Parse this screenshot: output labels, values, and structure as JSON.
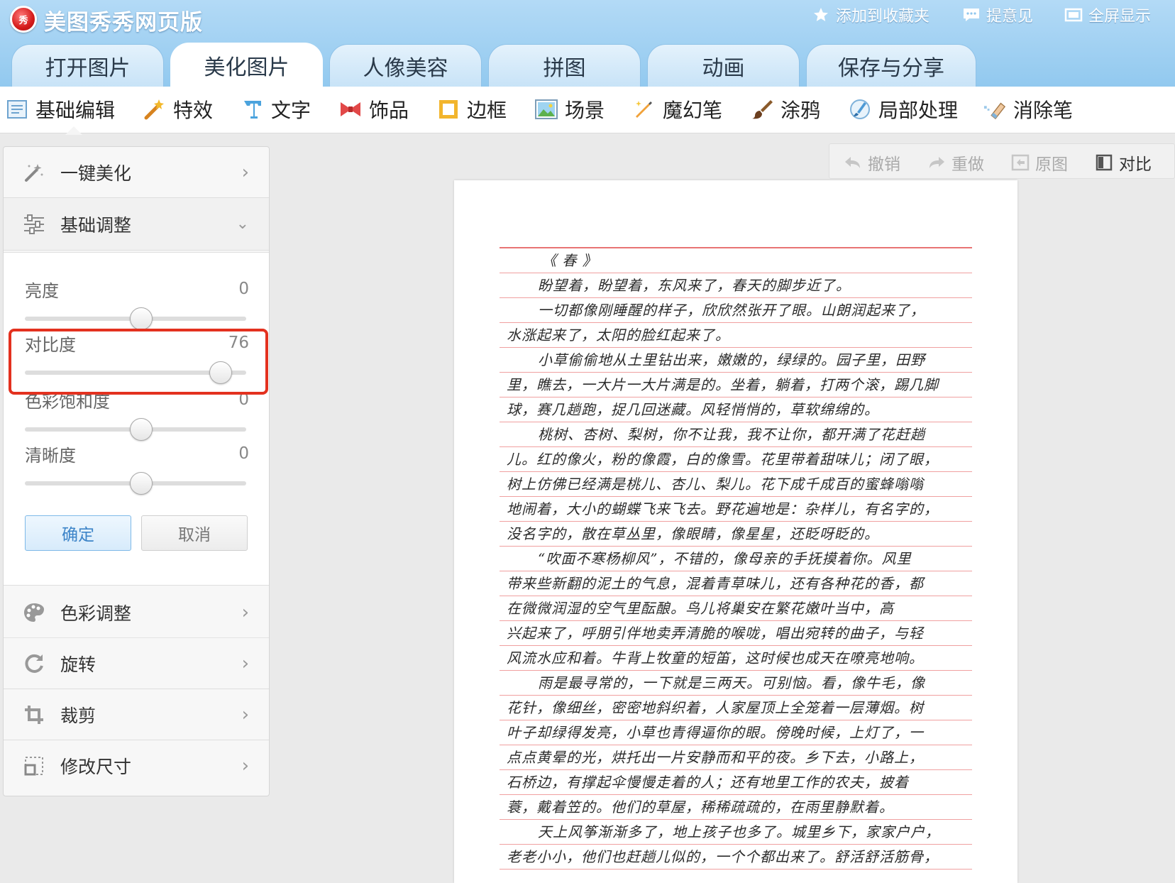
{
  "header": {
    "app_title": "美图秀秀网页版",
    "logo_text": "秀",
    "links": {
      "favorite": "添加到收藏夹",
      "feedback": "提意见",
      "fullscreen": "全屏显示"
    }
  },
  "tabs": [
    "打开图片",
    "美化图片",
    "人像美容",
    "拼图",
    "动画",
    "保存与分享"
  ],
  "active_tab": "美化图片",
  "toolbar": {
    "basic_edit": "基础编辑",
    "effects": "特效",
    "text": "文字",
    "accessories": "饰品",
    "border": "边框",
    "scene": "场景",
    "magic_pen": "魔幻笔",
    "graffiti": "涂鸦",
    "local_process": "局部处理",
    "eraser": "消除笔"
  },
  "panel": {
    "one_click": "一键美化",
    "basic_adjust": "基础调整",
    "sliders": {
      "brightness": {
        "label": "亮度",
        "value": "0",
        "level": 0.5
      },
      "contrast": {
        "label": "对比度",
        "value": "76",
        "level": 0.88
      },
      "saturation": {
        "label": "色彩饱和度",
        "value": "0",
        "level": 0.5
      },
      "sharpness": {
        "label": "清晰度",
        "value": "0",
        "level": 0.5
      }
    },
    "ok": "确定",
    "cancel": "取消",
    "color_adjust": "色彩调整",
    "rotate": "旋转",
    "crop": "裁剪",
    "resize": "修改尺寸"
  },
  "history": {
    "undo": "撤销",
    "redo": "重做",
    "original": "原图",
    "compare": "对比"
  },
  "document": {
    "title": "《 春 》",
    "lines": [
      "盼望着，盼望着，东风来了，春天的脚步近了。",
      "一切都像刚睡醒的样子，欣欣然张开了眼。山朗润起来了，",
      "水涨起来了，太阳的脸红起来了。",
      "小草偷偷地从土里钻出来，嫩嫩的，绿绿的。园子里，田野",
      "里，瞧去，一大片一大片满是的。坐着，躺着，打两个滚，踢几脚",
      "球，赛几趟跑，捉几回迷藏。风轻悄悄的，草软绵绵的。",
      "桃树、杏树、梨树，你不让我，我不让你，都开满了花赶趟",
      "儿。红的像火，粉的像霞，白的像雪。花里带着甜味儿；闭了眼，",
      "树上仿佛已经满是桃儿、杏儿、梨儿。花下成千成百的蜜蜂嗡嗡",
      "地闹着，大小的蝴蝶飞来飞去。野花遍地是：杂样儿，有名字的，",
      "没名字的，散在草丛里，像眼睛，像星星，还眨呀眨的。",
      "“吹面不寒杨柳风”，不错的，像母亲的手抚摸着你。风里",
      "带来些新翻的泥土的气息，混着青草味儿，还有各种花的香，都",
      "在微微润湿的空气里酝酿。鸟儿将巢安在繁花嫩叶当中，高",
      "兴起来了，呼朋引伴地卖弄清脆的喉咙，唱出宛转的曲子，与轻",
      "风流水应和着。牛背上牧童的短笛，这时候也成天在嘹亮地响。",
      "雨是最寻常的，一下就是三两天。可别恼。看，像牛毛，像",
      "花针，像细丝，密密地斜织着，人家屋顶上全笼着一层薄烟。树",
      "叶子却绿得发亮，小草也青得逼你的眼。傍晚时候，上灯了，一",
      "点点黄晕的光，烘托出一片安静而和平的夜。乡下去，小路上，",
      "石桥边，有撑起伞慢慢走着的人；还有地里工作的农夫，披着",
      "蓑，戴着笠的。他们的草屋，稀稀疏疏的，在雨里静默着。",
      "天上风筝渐渐多了，地上孩子也多了。城里乡下，家家户户，",
      "老老小小，他们也赶趟儿似的，一个个都出来了。舒活舒活筋骨，"
    ]
  }
}
